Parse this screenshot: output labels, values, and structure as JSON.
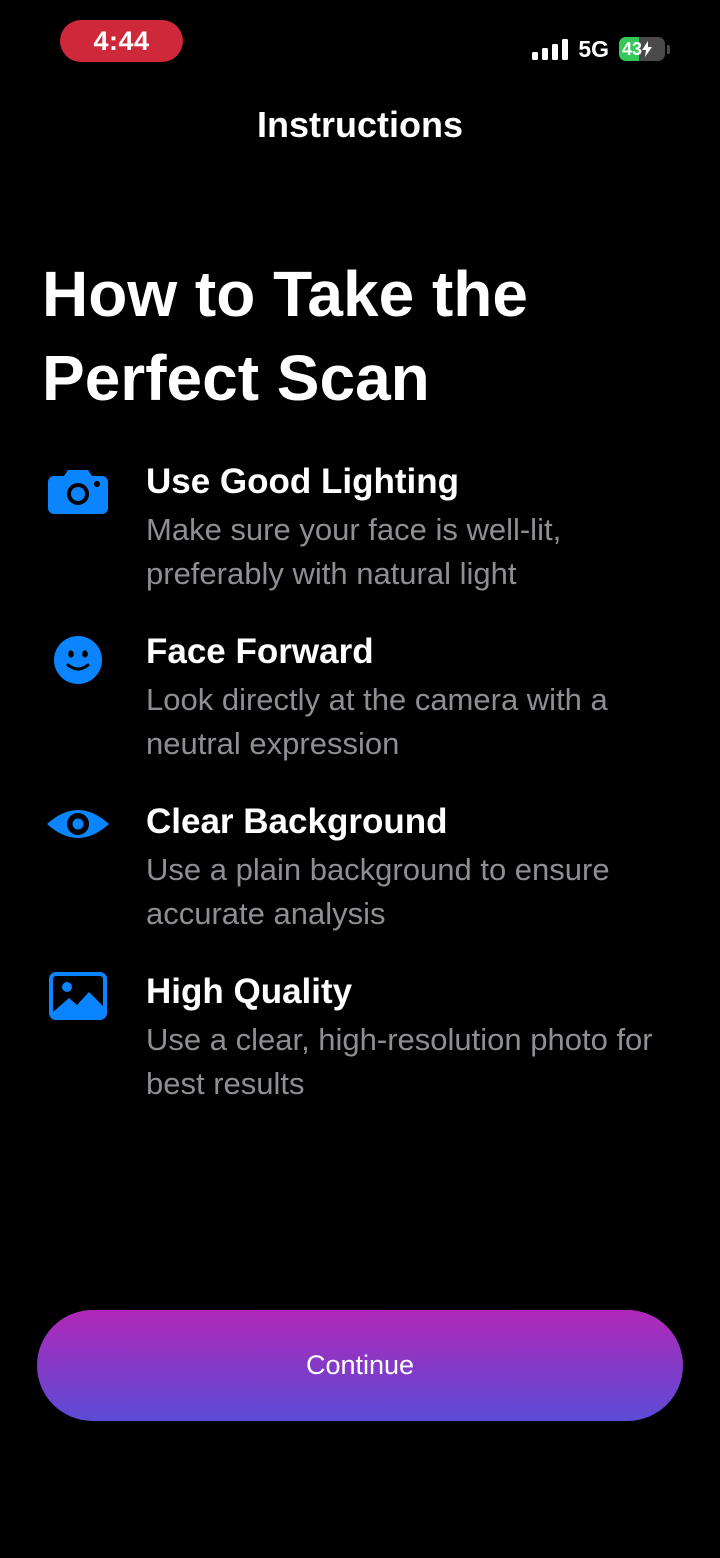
{
  "status_bar": {
    "time": "4:44",
    "network": "5G",
    "battery_percent": "43",
    "battery_level": 0.43,
    "time_pill_color": "#d0283b"
  },
  "nav": {
    "title": "Instructions"
  },
  "headline": "How to Take the Perfect Scan",
  "items": [
    {
      "icon": "camera-icon",
      "title": "Use Good Lighting",
      "description": "Make sure your face is well-lit, preferably with natural light"
    },
    {
      "icon": "smiley-face-icon",
      "title": "Face Forward",
      "description": "Look directly at the camera with a neutral expression"
    },
    {
      "icon": "eye-icon",
      "title": "Clear Background",
      "description": "Use a plain background to ensure accurate analysis"
    },
    {
      "icon": "photo-icon",
      "title": "High Quality",
      "description": "Use a clear, high-resolution photo for best results"
    }
  ],
  "continue_button": {
    "label": "Continue"
  },
  "colors": {
    "background": "#000000",
    "accent_blue": "#0a84ff",
    "secondary_text": "#8e8e93",
    "button_gradient_top": "#b128b7",
    "button_gradient_bottom": "#5a4bd6"
  }
}
